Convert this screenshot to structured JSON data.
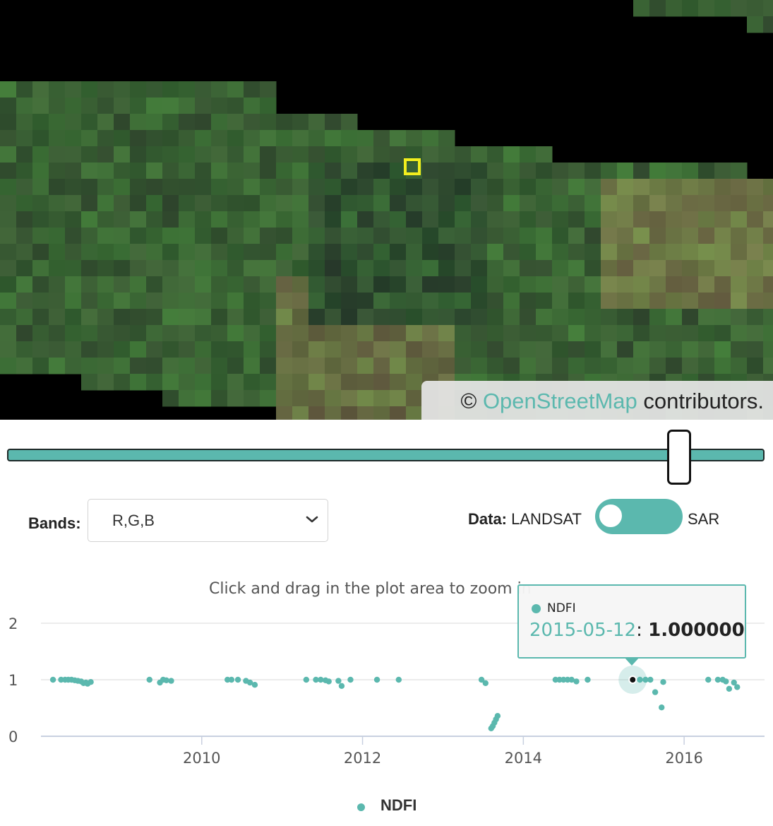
{
  "map": {
    "attribution_prefix": "©",
    "attribution_link": "OpenStreetMap",
    "attribution_suffix": "contributors."
  },
  "time_slider": {
    "position_fraction": 0.89
  },
  "bands": {
    "label": "Bands:",
    "selected": "R,G,B"
  },
  "data_source": {
    "label": "Data:",
    "left_option": "LANDSAT",
    "right_option": "SAR",
    "selected": "SAR"
  },
  "chart_hint": "Click and drag in the plot area to zoom in",
  "tooltip": {
    "series": "NDFI",
    "date": "2015-05-12",
    "value": "1.000000"
  },
  "colors": {
    "accent": "#5bb8ae",
    "marker_yellow": "#f2ee1e"
  },
  "chart_data": {
    "type": "scatter",
    "x_unit": "year (decimal)",
    "ylim": [
      0,
      2.2
    ],
    "xlim": [
      2008.0,
      2017.0
    ],
    "yticks": [
      "0",
      "1",
      "2"
    ],
    "xticks": [
      "2010",
      "2012",
      "2014",
      "2016"
    ],
    "grid": true,
    "legend_placement": "bottom-center",
    "series": [
      {
        "name": "NDFI",
        "points": [
          [
            2008.15,
            1.0
          ],
          [
            2008.25,
            1.0
          ],
          [
            2008.3,
            1.0
          ],
          [
            2008.34,
            1.0
          ],
          [
            2008.38,
            1.0
          ],
          [
            2008.42,
            0.99
          ],
          [
            2008.46,
            0.98
          ],
          [
            2008.5,
            0.97
          ],
          [
            2008.53,
            0.94
          ],
          [
            2008.56,
            0.95
          ],
          [
            2008.58,
            0.93
          ],
          [
            2008.62,
            0.96
          ],
          [
            2009.35,
            1.0
          ],
          [
            2009.48,
            0.95
          ],
          [
            2009.52,
            1.0
          ],
          [
            2009.56,
            0.99
          ],
          [
            2009.62,
            0.98
          ],
          [
            2010.32,
            1.0
          ],
          [
            2010.37,
            1.0
          ],
          [
            2010.45,
            1.0
          ],
          [
            2010.55,
            0.98
          ],
          [
            2010.6,
            0.95
          ],
          [
            2010.66,
            0.91
          ],
          [
            2011.3,
            1.0
          ],
          [
            2011.42,
            1.0
          ],
          [
            2011.48,
            1.0
          ],
          [
            2011.54,
            0.99
          ],
          [
            2011.58,
            0.97
          ],
          [
            2011.7,
            0.98
          ],
          [
            2011.74,
            0.89
          ],
          [
            2011.85,
            1.0
          ],
          [
            2012.18,
            1.0
          ],
          [
            2012.45,
            1.0
          ],
          [
            2013.48,
            1.0
          ],
          [
            2013.53,
            0.94
          ],
          [
            2013.6,
            0.14
          ],
          [
            2013.62,
            0.18
          ],
          [
            2013.64,
            0.24
          ],
          [
            2013.66,
            0.3
          ],
          [
            2013.68,
            0.36
          ],
          [
            2014.4,
            1.0
          ],
          [
            2014.45,
            1.0
          ],
          [
            2014.5,
            1.0
          ],
          [
            2014.55,
            1.0
          ],
          [
            2014.6,
            1.0
          ],
          [
            2014.66,
            0.97
          ],
          [
            2014.8,
            1.0
          ],
          [
            2015.36,
            1.0
          ],
          [
            2015.45,
            1.0
          ],
          [
            2015.52,
            1.0
          ],
          [
            2015.58,
            1.0
          ],
          [
            2015.64,
            0.78
          ],
          [
            2015.72,
            0.51
          ],
          [
            2015.74,
            0.96
          ],
          [
            2016.3,
            1.0
          ],
          [
            2016.42,
            1.0
          ],
          [
            2016.48,
            1.0
          ],
          [
            2016.52,
            0.97
          ],
          [
            2016.56,
            0.84
          ],
          [
            2016.62,
            0.95
          ],
          [
            2016.66,
            0.87
          ]
        ]
      }
    ],
    "highlighted_point": [
      2015.36,
      1.0
    ]
  }
}
